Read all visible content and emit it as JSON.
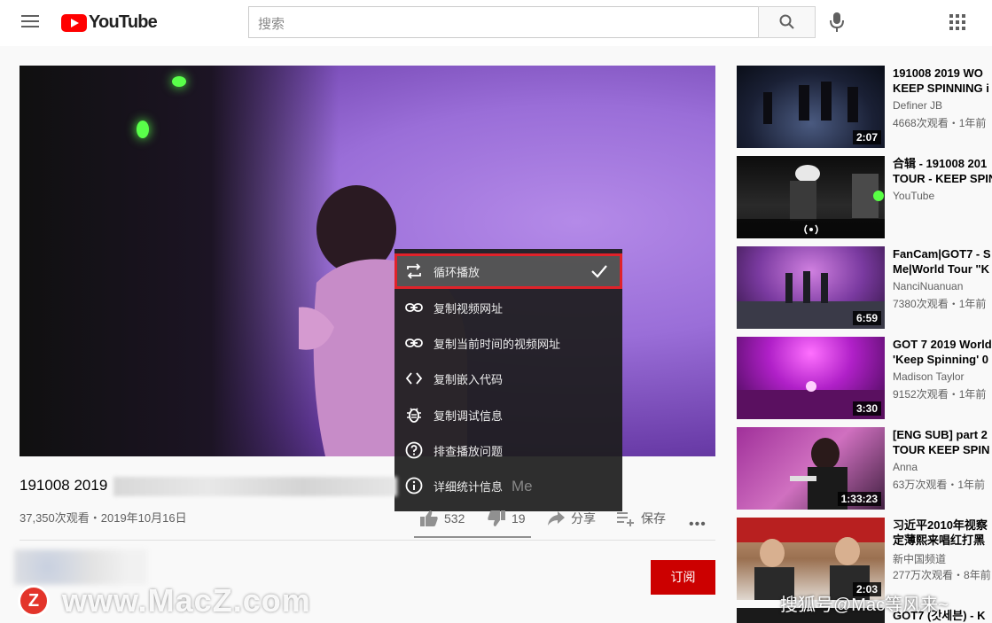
{
  "header": {
    "logo_text": "YouTube",
    "search_placeholder": "搜索"
  },
  "context_menu": {
    "items": [
      {
        "label": "循环播放",
        "icon": "loop-icon",
        "checked": true
      },
      {
        "label": "复制视频网址",
        "icon": "link-icon"
      },
      {
        "label": "复制当前时间的视频网址",
        "icon": "link-icon"
      },
      {
        "label": "复制嵌入代码",
        "icon": "code-icon"
      },
      {
        "label": "复制调试信息",
        "icon": "bug-icon"
      },
      {
        "label": "排查播放问题",
        "icon": "help-icon"
      },
      {
        "label": "详细统计信息",
        "icon": "info-icon"
      }
    ]
  },
  "video": {
    "title_start": "191008 2019",
    "title_end": "Me",
    "meta": "37,350次观看・2019年10月16日",
    "likes": "532",
    "dislikes": "19",
    "share_label": "分享",
    "save_label": "保存",
    "more": "•••"
  },
  "subscribe_label": "订阅",
  "watermarks": {
    "macz_logo": "Z",
    "macz_text": "www.MacZ.com",
    "sohu_text": "搜狐号@Mac等风来~"
  },
  "recommendations": [
    {
      "title_line1": "191008 2019 WO",
      "title_line2": "KEEP SPINNING i",
      "channel": "Definer JB",
      "views": "4668次观看・1年前",
      "duration": "2:07"
    },
    {
      "title_line1": "合辑 - 191008 201",
      "title_line2": "TOUR - KEEP SPIN",
      "channel": "YouTube",
      "views": "",
      "duration": ""
    },
    {
      "title_line1": "FanCam|GOT7 - S",
      "title_line2": "Me|World Tour \"K",
      "channel": "NanciNuanuan",
      "views": "7380次观看・1年前",
      "duration": "6:59"
    },
    {
      "title_line1": "GOT 7 2019 World",
      "title_line2": "'Keep Spinning' 0",
      "channel": "Madison Taylor",
      "views": "9152次观看・1年前",
      "duration": "3:30"
    },
    {
      "title_line1": "[ENG SUB] part 2",
      "title_line2": "TOUR KEEP SPIN",
      "channel": "Anna",
      "views": "63万次观看・1年前",
      "duration": "1:33:23"
    },
    {
      "title_line1": "习近平2010年视察",
      "title_line2": "定薄熙来唱红打黑",
      "channel": "新中国频道",
      "views": "277万次观看・8年前",
      "duration": "2:03"
    },
    {
      "title_line1": "GOT7 (갓세븐) - K",
      "title_line2": "",
      "channel": "",
      "views": "",
      "duration": ""
    }
  ]
}
